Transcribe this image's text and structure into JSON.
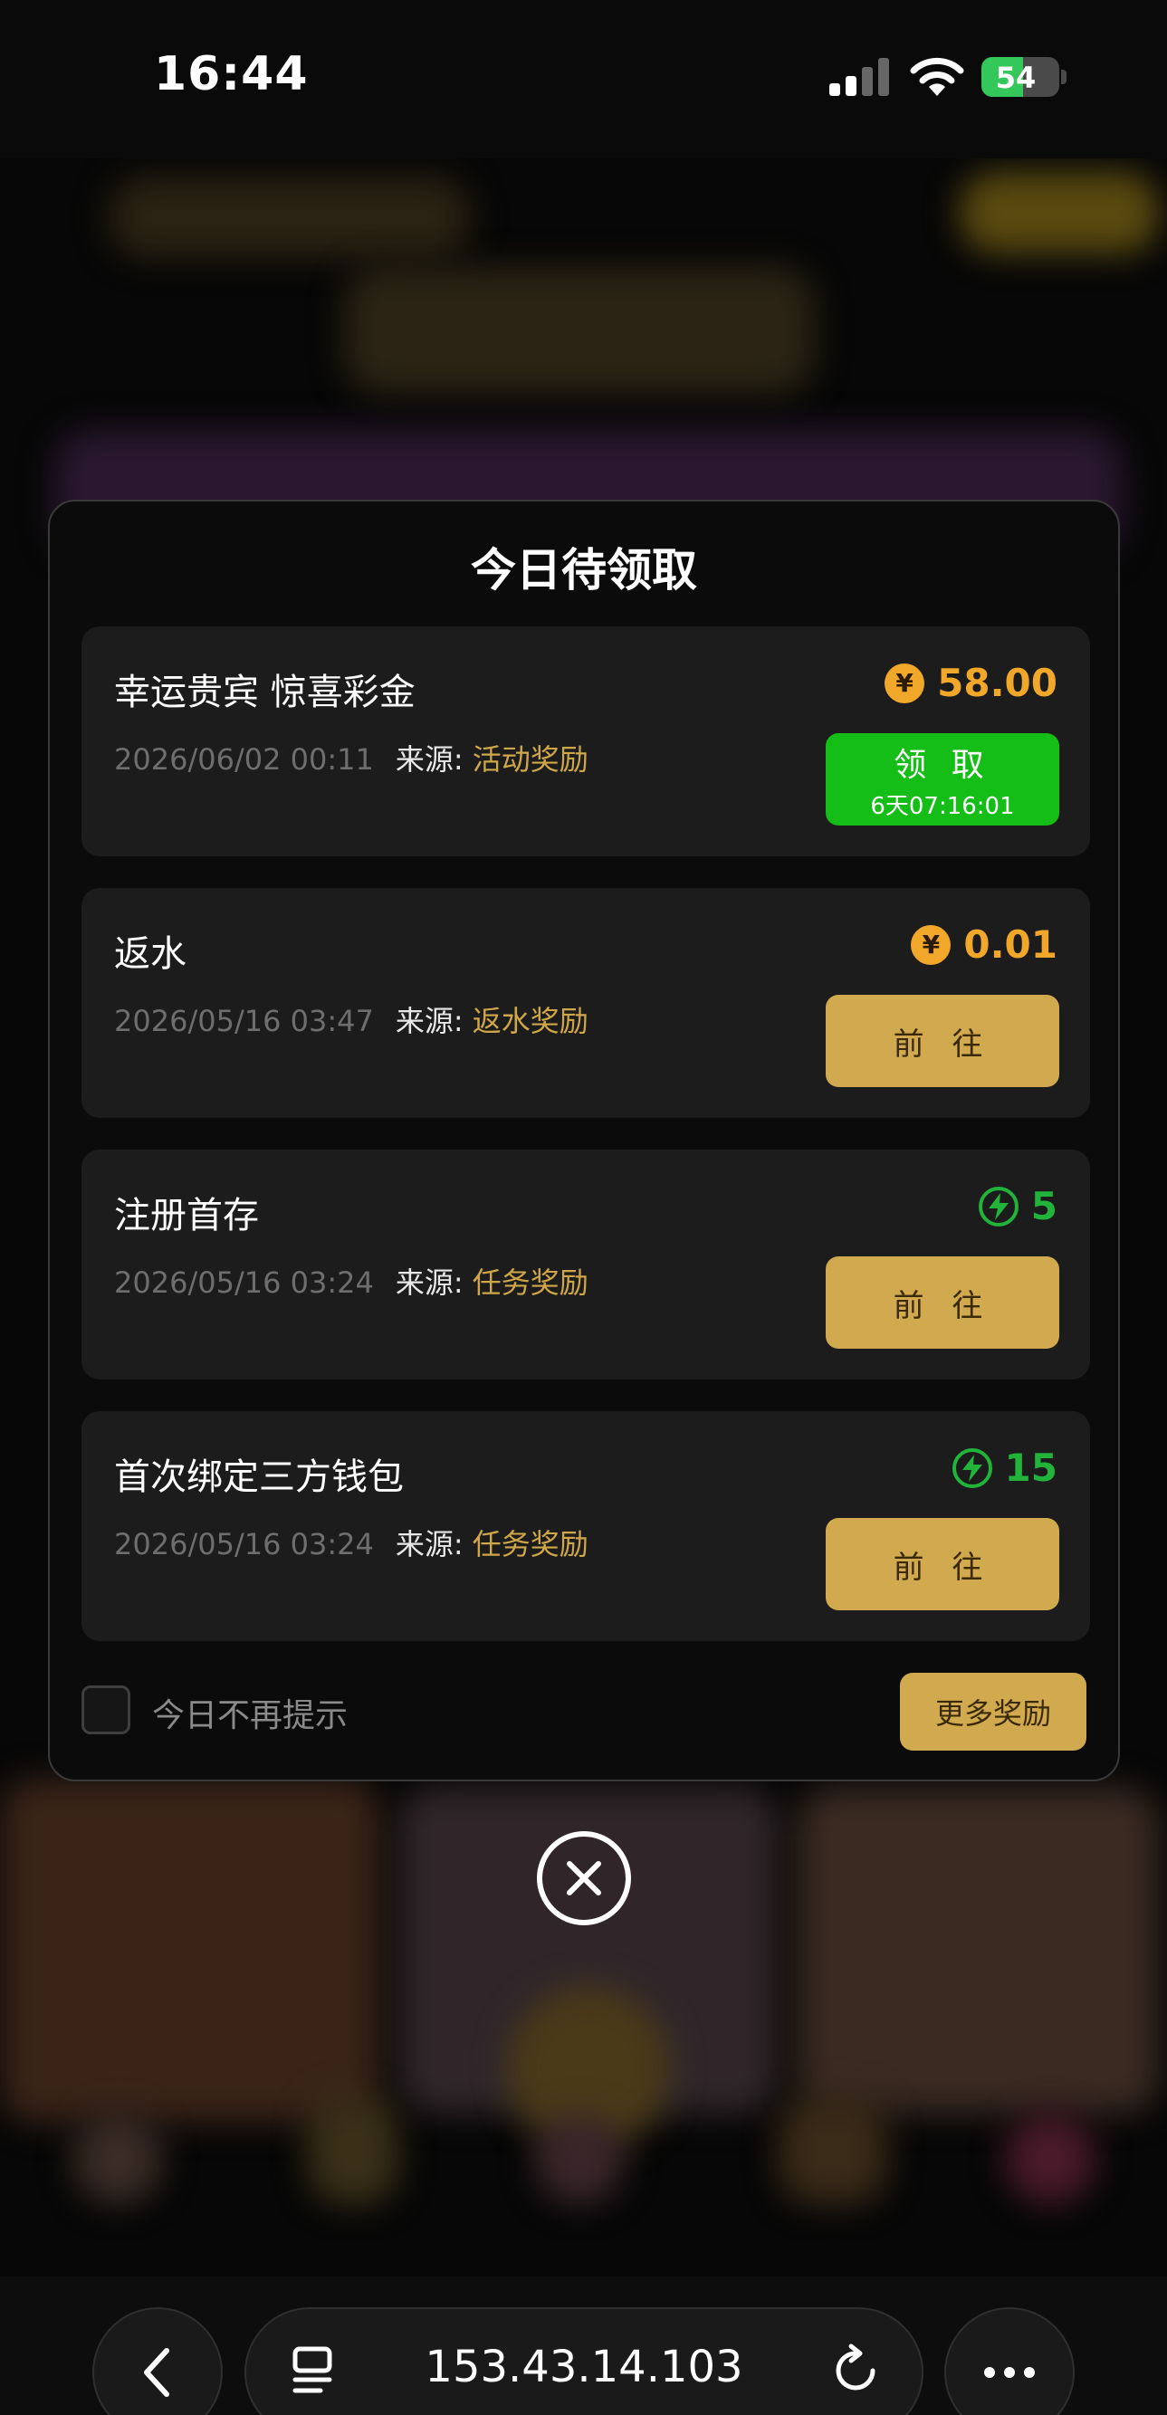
{
  "status_bar": {
    "time": "16:44",
    "battery": "54",
    "battery_level": 0.54
  },
  "modal": {
    "title": "今日待领取",
    "source_label": "来源:",
    "items": [
      {
        "name": "幸运贵宾 惊喜彩金",
        "datetime": "2026/06/02 00:11",
        "source": "活动奖励",
        "amount": "58.00",
        "amount_icon": "coin-icon",
        "amount_color": "#f1a72a",
        "button": "领 取",
        "button_sub": "6天07:16:01",
        "button_color": "#14be17"
      },
      {
        "name": "返水",
        "datetime": "2026/05/16 03:47",
        "source": "返水奖励",
        "amount": "0.01",
        "amount_icon": "coin-icon",
        "amount_color": "#f1a72a",
        "button": "前 往",
        "button_color": "#d1a94f"
      },
      {
        "name": "注册首存",
        "datetime": "2026/05/16 03:24",
        "source": "任务奖励",
        "amount": "5",
        "amount_icon": "lightning-icon",
        "amount_color": "#22b33a",
        "button": "前 往",
        "button_color": "#d1a94f"
      },
      {
        "name": "首次绑定三方钱包",
        "datetime": "2026/05/16 03:24",
        "source": "任务奖励",
        "amount": "15",
        "amount_icon": "lightning-icon",
        "amount_color": "#22b33a",
        "button": "前 往",
        "button_color": "#d1a94f"
      }
    ],
    "dont_show_today": "今日不再提示",
    "more_rewards": "更多奖励"
  },
  "browser": {
    "url": "153.43.14.103"
  },
  "colors": {
    "accent_gold": "#d1a94f",
    "claim_green": "#14be17",
    "background": "#050505"
  }
}
